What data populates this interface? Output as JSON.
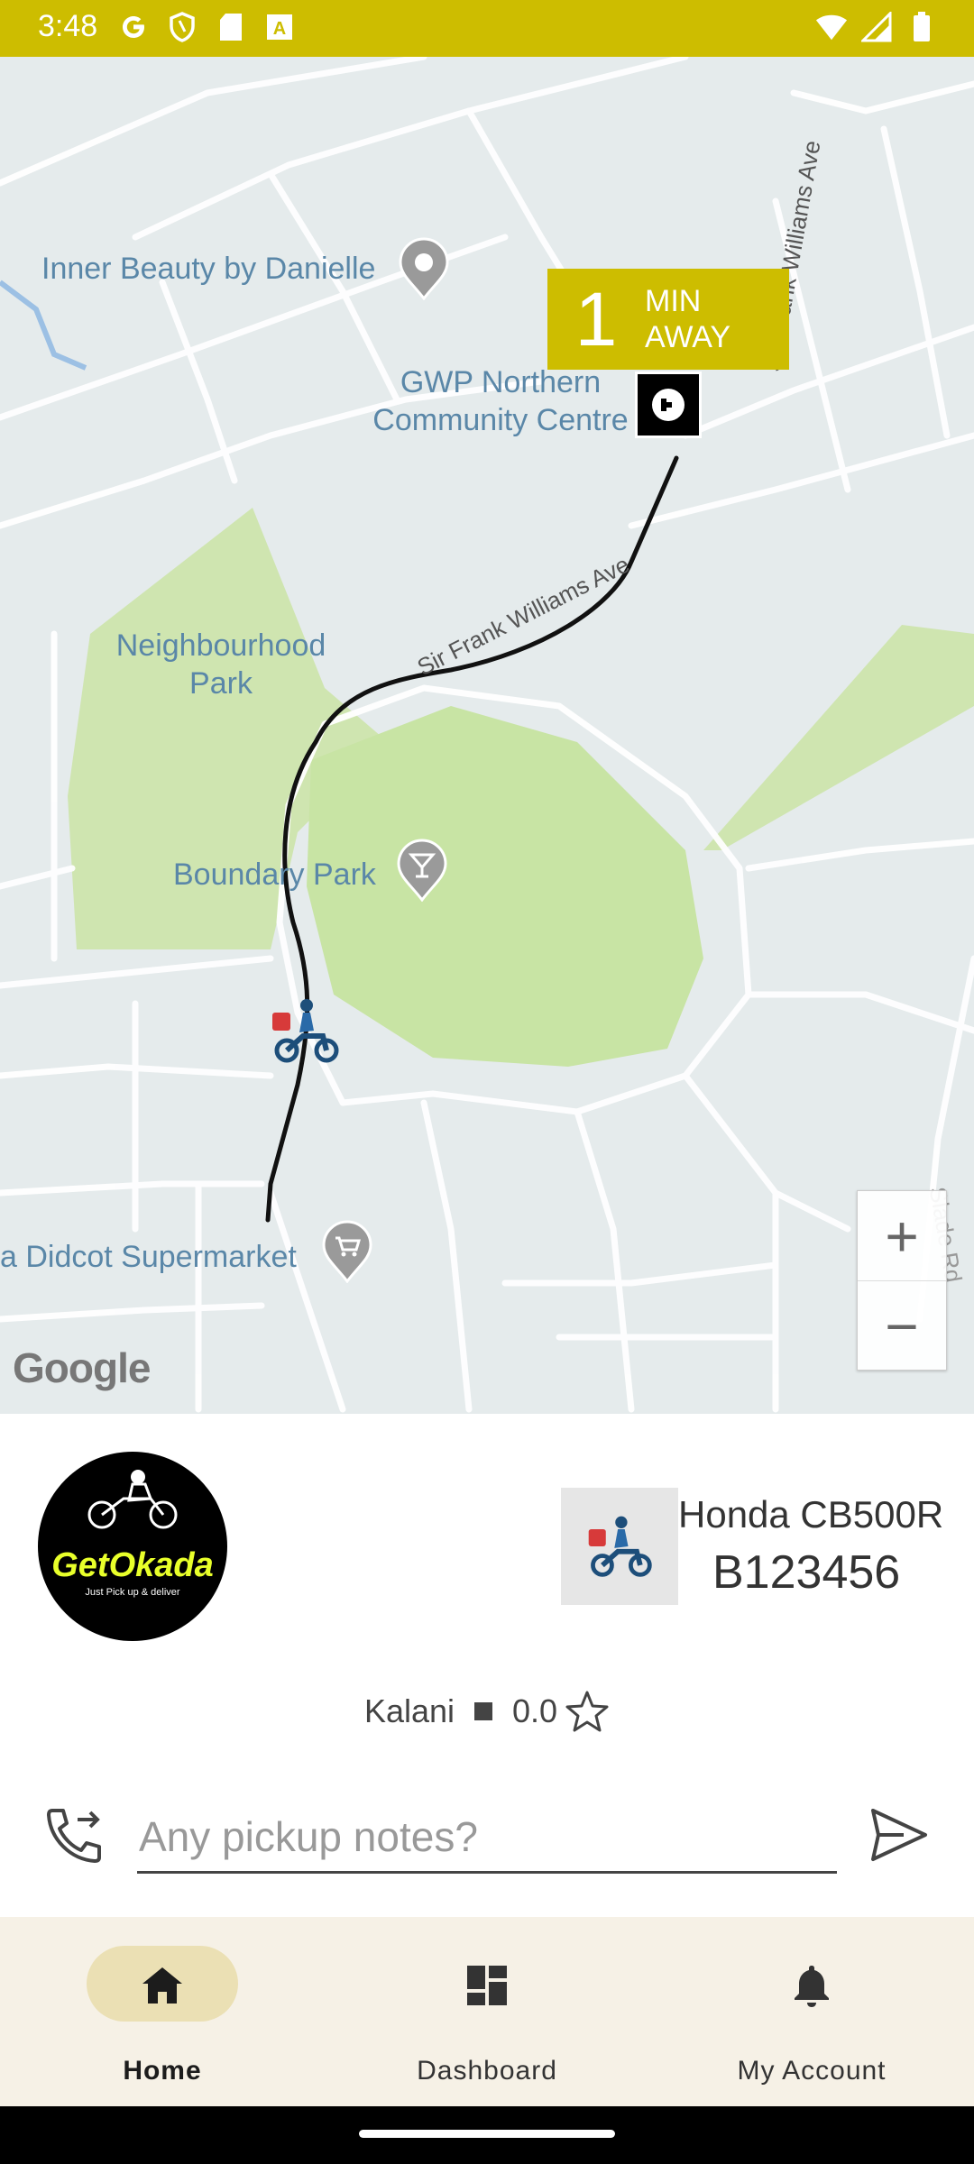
{
  "status_bar": {
    "time": "3:48",
    "left_icons": [
      "google-icon",
      "shield-icon",
      "sd-card-icon",
      "text-icon"
    ],
    "right_icons": [
      "wifi-icon",
      "signal-icon",
      "battery-icon"
    ],
    "background": "#cdbd00"
  },
  "map": {
    "labels": {
      "inner_beauty": "Inner Beauty by Danielle",
      "gwp_line1": "GWP Northern",
      "gwp_line2": "Community Centre",
      "neighbourhood_line1": "Neighbourhood",
      "neighbourhood_line2": "Park",
      "boundary_park": "Boundary Park",
      "supermarket": "a Didcot Supermarket",
      "road_sir_frank": "Sir Frank Williams Ave",
      "road_sir_frank_2": "Sir Frank Williams Ave",
      "road_sir_frank_3": "Sir Frank Williams Ave",
      "road_slade": "Slade Rd"
    },
    "eta": {
      "number": "1",
      "line1": "MIN",
      "line2": "AWAY"
    },
    "google_logo": "Google",
    "zoom_in": "+",
    "zoom_out": "−"
  },
  "driver": {
    "brand_name": "GetOkada",
    "brand_tagline": "Just Pick up & deliver",
    "vehicle_model": "Honda CB500R",
    "plate": "B123456",
    "rider_name": "Kalani",
    "rating": "0.0"
  },
  "notes": {
    "placeholder": "Any pickup notes?",
    "value": ""
  },
  "nav": {
    "items": [
      {
        "label": "Home",
        "icon": "home-icon",
        "active": true
      },
      {
        "label": "Dashboard",
        "icon": "dashboard-icon",
        "active": false
      },
      {
        "label": "My Account",
        "icon": "bell-icon",
        "active": false
      }
    ]
  }
}
